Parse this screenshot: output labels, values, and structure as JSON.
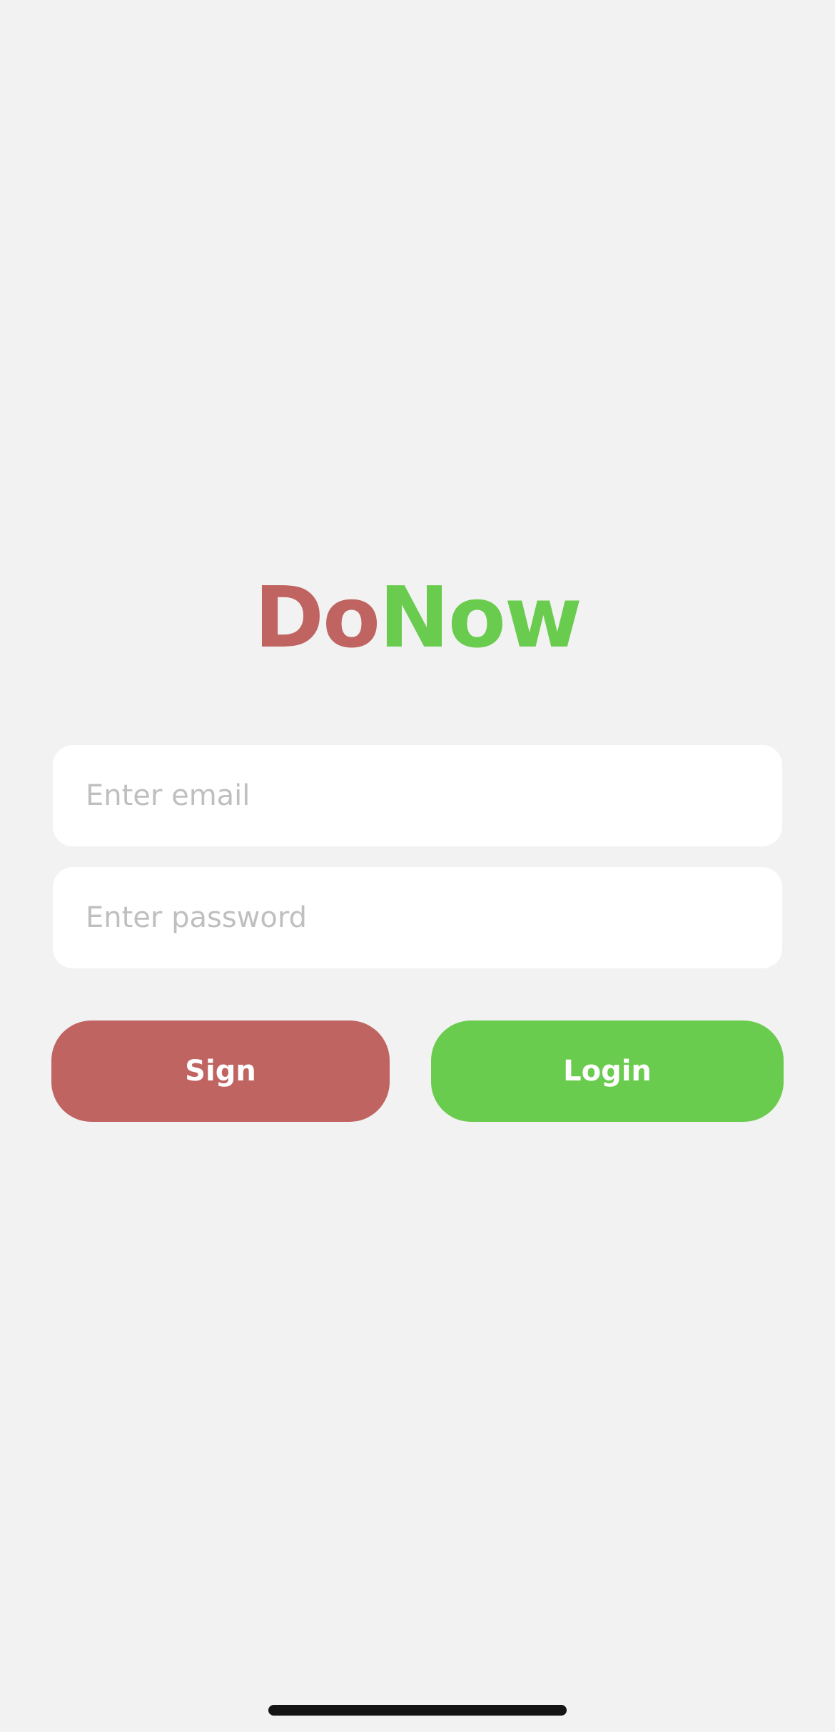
{
  "app": {
    "logo_part1": "Do",
    "logo_part2": "Now"
  },
  "form": {
    "email_placeholder": "Enter email",
    "email_value": "",
    "password_placeholder": "Enter password",
    "password_value": ""
  },
  "buttons": {
    "sign_label": "Sign",
    "login_label": "Login"
  },
  "colors": {
    "background": "#f2f2f2",
    "sign_red": "#c06462",
    "login_green": "#6acc4e",
    "placeholder_gray": "#bfbfbf",
    "field_white": "#ffffff",
    "home_indicator": "#141414"
  }
}
